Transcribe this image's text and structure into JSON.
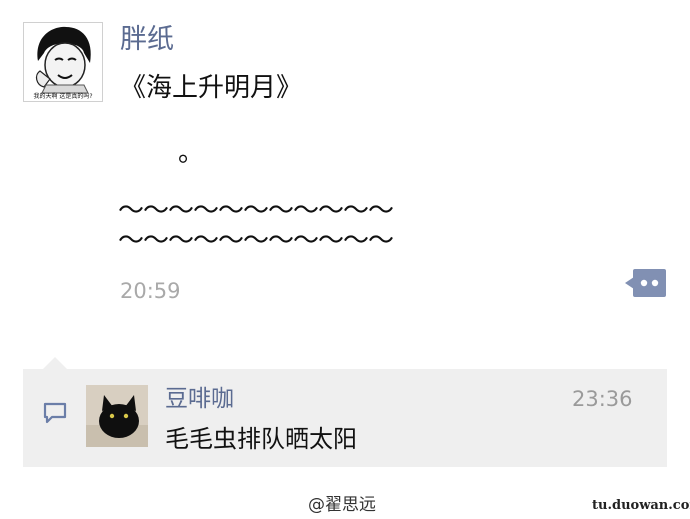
{
  "post": {
    "author": "胖纸",
    "avatar_caption": "我的天啊 这是真的吗?",
    "title": "《海上升明月》",
    "dot": "。",
    "wave_line_1": "～～～～～～～～～～～",
    "wave_line_2": "～～～～～～～～～～～",
    "time": "20:59"
  },
  "comment": {
    "author": "豆啡咖",
    "time": "23:36",
    "text": "毛毛虫排队晒太阳"
  },
  "watermark": {
    "handle": "@翟思远",
    "site": "tu.duowan.com"
  },
  "colors": {
    "name_link": "#5b6b91",
    "time_gray": "#a9a9a9",
    "comment_bg": "#efefef",
    "more_button": "#8190b3"
  },
  "icons": [
    "meme-face-avatar",
    "more-dots-icon",
    "comment-bubble-icon",
    "black-cat-avatar"
  ]
}
